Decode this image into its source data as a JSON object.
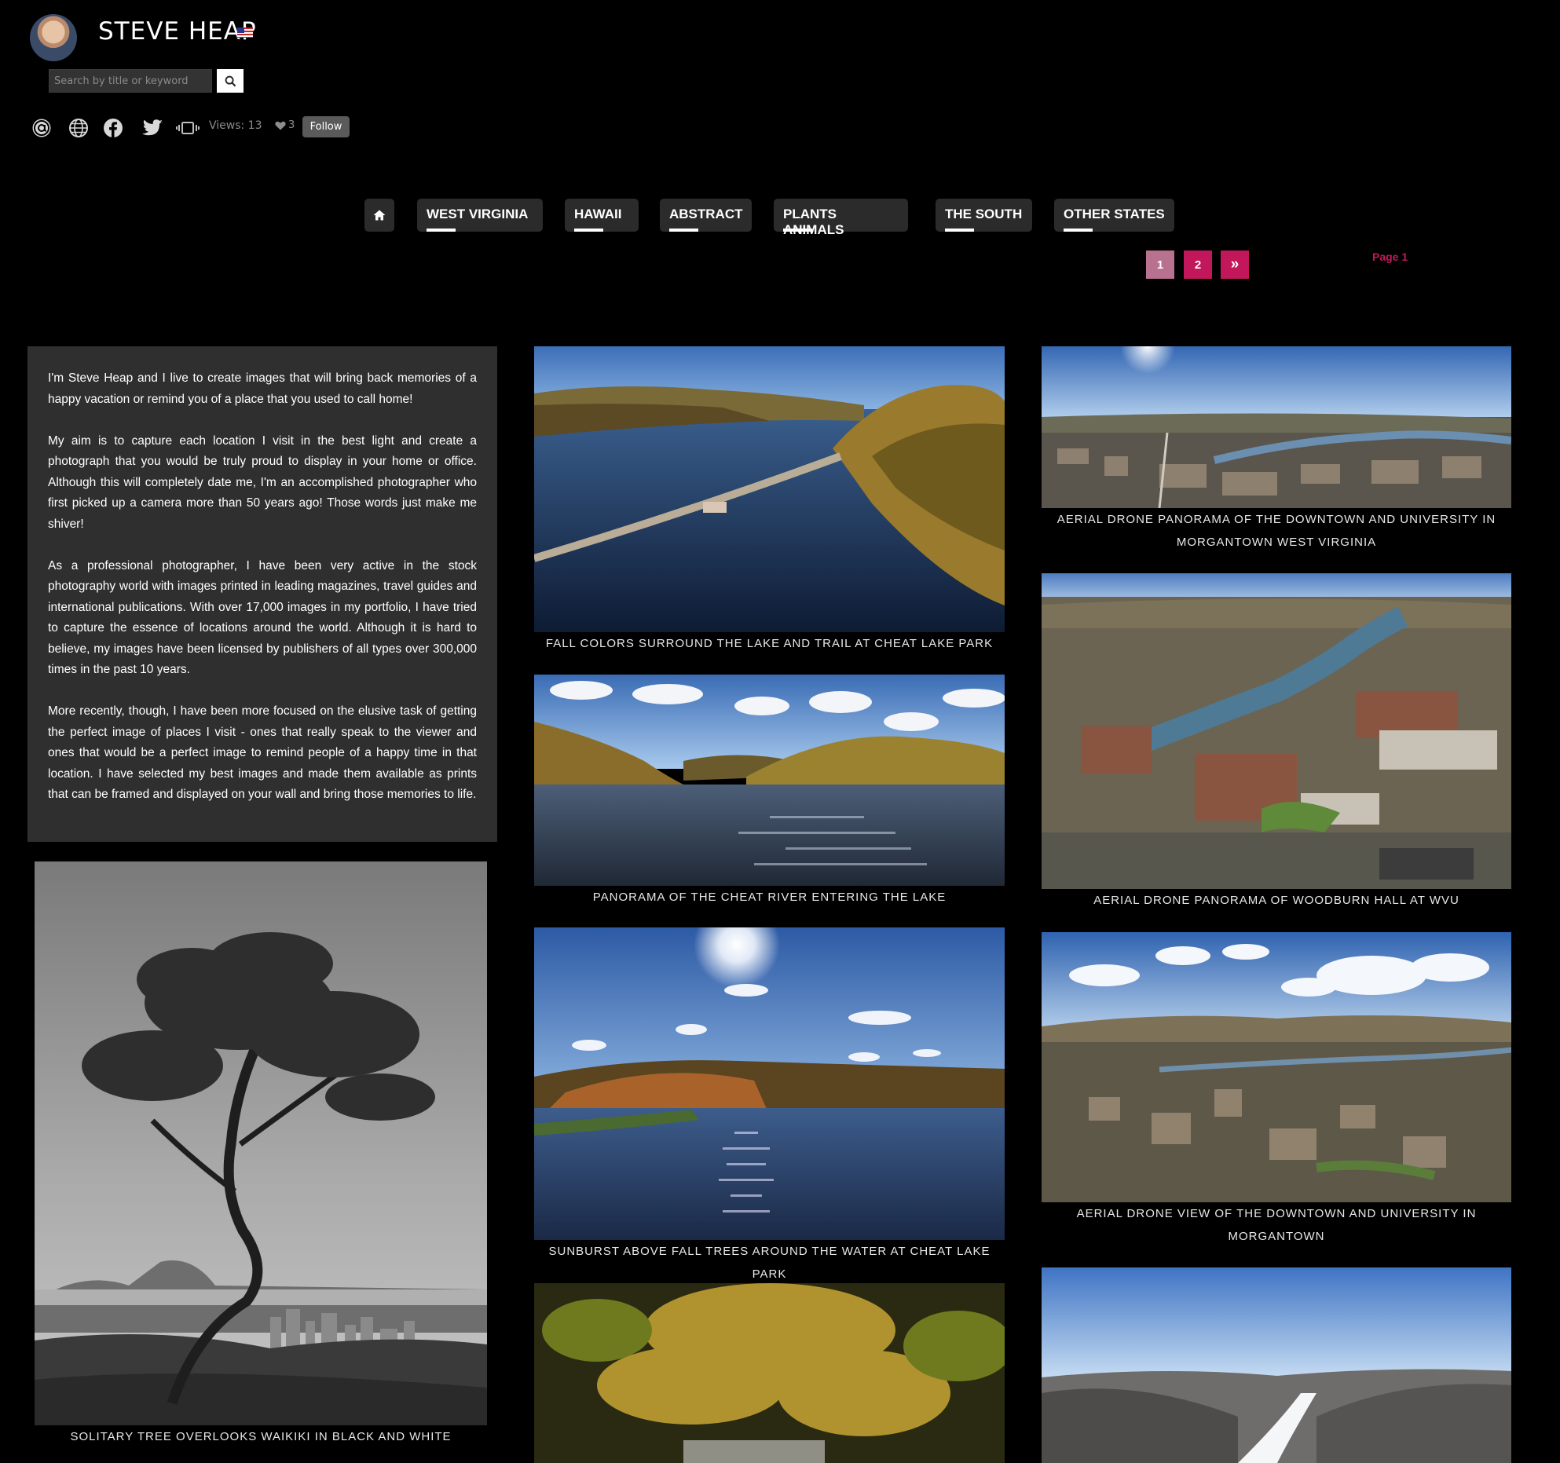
{
  "header": {
    "artist_name": "STEVE HEAP",
    "search_placeholder": "Search by title or keyword",
    "views_text": "Views: 13",
    "likes_count": "3",
    "follow_label": "Follow"
  },
  "nav": {
    "tabs": [
      "WEST VIRGINIA",
      "HAWAII",
      "ABSTRACT",
      "PLANTS ANIMALS",
      "THE SOUTH",
      "OTHER STATES"
    ]
  },
  "pagination": {
    "pages": [
      "1",
      "2"
    ],
    "next_label": "»",
    "current_indicator": "Page 1"
  },
  "colors": {
    "accent_pink": "#c2185b",
    "active_page": "#b8728f",
    "panel": "#2f2f2f"
  },
  "bio": {
    "paragraphs": [
      "I'm Steve Heap and I live to create images that will bring back memories of a happy vacation or remind you of a place that you used to call home!",
      "My aim is to capture each location I visit in the best light and create a photograph that you would be truly proud to display in your home or office. Although this will completely date me, I'm an accomplished photographer who first picked up a camera more than 50 years ago! Those words just make me shiver!",
      "As a professional photographer, I have been very active in the stock photography world with images printed in leading magazines, travel guides and international publications. With over 17,000 images in my portfolio, I have tried to capture the essence of locations around the world. Although it is hard to believe, my images have been licensed by publishers of all types over 300,000 times in the past 10 years.",
      "More recently, though, I have been more focused on the elusive task of getting the perfect image of places I visit - ones that really speak to the viewer and ones that would be a perfect image to remind people of a happy time in that location. I have selected my best images and made them available as prints that can be framed and displayed on your wall and bring those memories to life."
    ]
  },
  "gallery": {
    "captions": [
      "SOLITARY TREE OVERLOOKS WAIKIKI IN BLACK AND WHITE",
      "FALL COLORS SURROUND THE LAKE AND TRAIL AT CHEAT LAKE PARK",
      "PANORAMA OF THE CHEAT RIVER ENTERING THE LAKE",
      "SUNBURST ABOVE FALL TREES AROUND THE WATER AT CHEAT LAKE PARK",
      "AERIAL DRONE PANORAMA OF THE DOWNTOWN AND UNIVERSITY IN MORGANTOWN WEST VIRGINIA",
      "AERIAL DRONE PANORAMA OF WOODBURN HALL AT WVU",
      "AERIAL DRONE VIEW OF THE DOWNTOWN AND UNIVERSITY IN MORGANTOWN"
    ]
  }
}
